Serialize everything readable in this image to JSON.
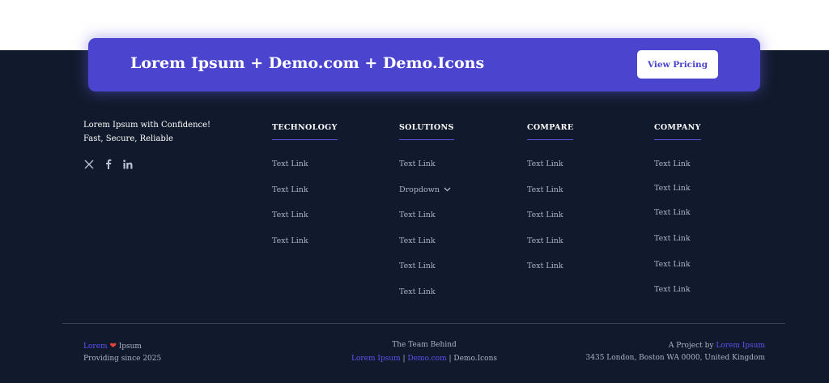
{
  "cta": {
    "title": "Lorem Ipsum + Demo.com + Demo.Icons",
    "button_label": "View Pricing"
  },
  "brand": {
    "line1": "Lorem Ipsum with Confidence!",
    "line2": "Fast, Secure, Reliable",
    "socials": [
      "x-icon",
      "facebook-icon",
      "linkedin-icon"
    ]
  },
  "columns": [
    {
      "heading": "TECHNOLOGY",
      "links": [
        "Text Link",
        "Text Link",
        "Text Link",
        "Text Link"
      ]
    },
    {
      "heading": "SOLUTIONS",
      "links": [
        "Text Link",
        "Dropdown",
        "Text Link",
        "Text Link",
        "Text Link",
        "Text Link"
      ]
    },
    {
      "heading": "COMPARE",
      "links": [
        "Text Link",
        "Text Link",
        "Text Link",
        "Text Link",
        "Text Link"
      ]
    },
    {
      "heading": "COMPANY",
      "links": [
        "Text Link",
        "Text Link",
        "Text Link",
        "Text Link",
        "Text Link",
        "Text Link"
      ]
    }
  ],
  "bottom": {
    "left": {
      "brand_a": "Lorem",
      "brand_b": "Ipsum",
      "since": "Providing since 2025"
    },
    "center": {
      "line1": "The Team Behind",
      "link_a": "Lorem Ipsum",
      "sep1": " | ",
      "link_b": "Demo.com",
      "sep2": " | ",
      "tail": "Demo.Icons"
    },
    "right": {
      "prefix": "A Project by ",
      "link": "Lorem Ipsum",
      "address": "3435 London, Boston WA 0000, United Kingdom"
    }
  },
  "colors": {
    "accent": "#4a44cf",
    "footer_bg": "#111a2c",
    "heart": "#e8423a",
    "link_accent": "#5b52f0"
  }
}
